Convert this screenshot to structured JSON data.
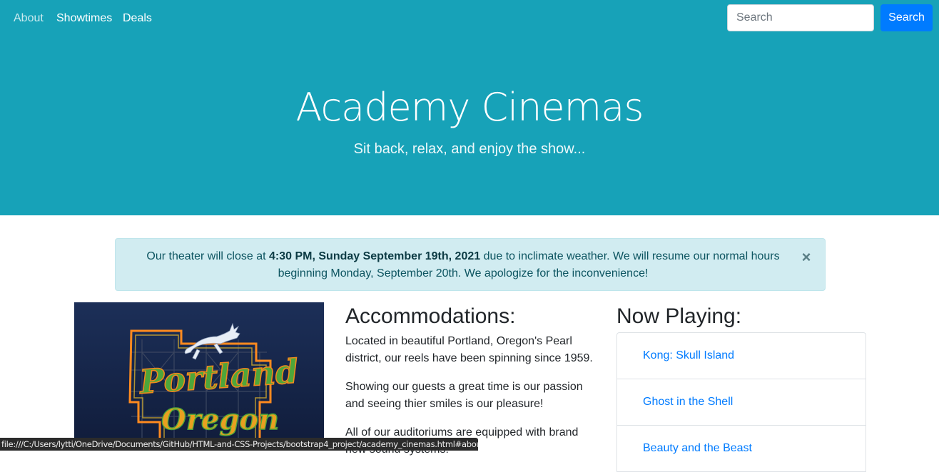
{
  "nav": {
    "links": [
      {
        "label": "About",
        "active": false
      },
      {
        "label": "Showtimes",
        "active": true
      },
      {
        "label": "Deals",
        "active": true
      }
    ],
    "search": {
      "placeholder": "Search",
      "button_label": "Search"
    }
  },
  "hero": {
    "title": "Academy Cinemas",
    "subtitle": "Sit back, relax, and enjoy the show..."
  },
  "alert": {
    "prefix": "Our theater will close at ",
    "bold": "4:30 PM, Sunday September 19th, 2021",
    "suffix": " due to inclimate weather. We will resume our normal hours beginning Monday, September 20th. We apologize for the inconvenience!",
    "close_label": "×"
  },
  "accommodations": {
    "title": "Accommodations:",
    "paragraphs": [
      "Located in beautiful Portland, Oregon's Pearl district, our reels have been spinning since 1959.",
      "Showing our guests a great time is our passion and seeing thier smiles is our pleasure!",
      "All of our auditoriums are equipped with brand new sound systems!"
    ]
  },
  "now_playing": {
    "title": "Now Playing:",
    "movies": [
      "Kong: Skull Island",
      "Ghost in the Shell",
      "Beauty and the Beast"
    ]
  },
  "image": {
    "sign_line1": "Portland",
    "sign_line2": "Oregon"
  },
  "status_bar": {
    "url": "file:///C:/Users/lytti/OneDrive/Documents/GitHub/HTML-and-CSS-Projects/bootstrap4_project/academy_cinemas.html#about"
  },
  "colors": {
    "brand": "#17a2b8",
    "primary": "#007bff",
    "alert_bg": "#d1ecf1",
    "alert_text": "#0c5460"
  }
}
